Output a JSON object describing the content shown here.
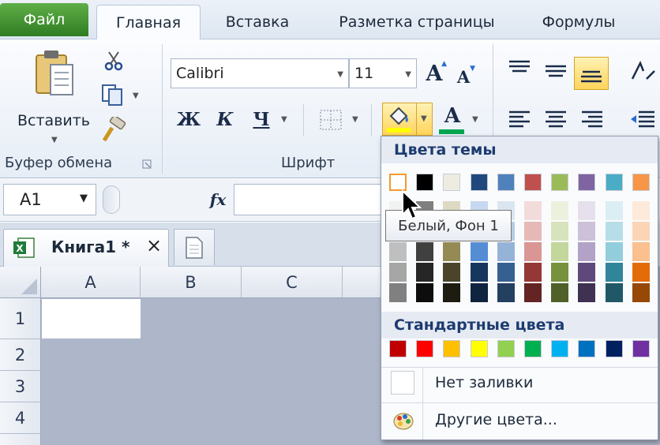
{
  "tabs": {
    "file": "Файл",
    "home": "Главная",
    "insert": "Вставка",
    "page_layout": "Разметка страницы",
    "formulas": "Формулы"
  },
  "clipboard": {
    "paste_label": "Вставить",
    "group_label": "Буфер обмена"
  },
  "font": {
    "name": "Calibri",
    "size": "11",
    "group_label": "Шрифт",
    "bold": "Ж",
    "italic": "К",
    "underline": "Ч",
    "grow_glyph": "A",
    "shrink_glyph": "A",
    "font_color_glyph": "A",
    "font_color_bar": "#00a651",
    "fill_color_bar": "#ffff00"
  },
  "formula_bar": {
    "name_box": "A1",
    "fx_label": "fx"
  },
  "workbook": {
    "tab_title": "Книга1 *",
    "close_glyph": "×"
  },
  "grid": {
    "columns": [
      "A",
      "B",
      "C"
    ],
    "rows": [
      "1",
      "2",
      "3",
      "4"
    ],
    "selected_cell": "A1"
  },
  "palette": {
    "theme_title": "Цвета темы",
    "theme_colors": [
      "#ffffff",
      "#000000",
      "#eeece1",
      "#1f497d",
      "#4f81bd",
      "#c0504d",
      "#9bbb59",
      "#8064a2",
      "#4bacc6",
      "#f79646"
    ],
    "theme_shades": [
      [
        "#f2f2f2",
        "#d9d9d9",
        "#bfbfbf",
        "#a6a6a6",
        "#808080"
      ],
      [
        "#7f7f7f",
        "#595959",
        "#404040",
        "#262626",
        "#0d0d0d"
      ],
      [
        "#ddd9c3",
        "#c4bd97",
        "#948a54",
        "#4a452a",
        "#1e1c11"
      ],
      [
        "#c6d9f0",
        "#8db3e2",
        "#548dd4",
        "#17365d",
        "#0f243e"
      ],
      [
        "#dbe5f1",
        "#b8cce4",
        "#95b3d7",
        "#366092",
        "#244061"
      ],
      [
        "#f2dcdb",
        "#e5b9b7",
        "#d99694",
        "#953734",
        "#632423"
      ],
      [
        "#ebf1dd",
        "#d7e3bc",
        "#c3d69b",
        "#76923c",
        "#4f6128"
      ],
      [
        "#e5e0ec",
        "#ccc1d9",
        "#b2a2c7",
        "#5f497a",
        "#3f3151"
      ],
      [
        "#dbeef3",
        "#b7dde8",
        "#92cddc",
        "#31859b",
        "#205867"
      ],
      [
        "#fdeada",
        "#fbd5b5",
        "#fac08f",
        "#e36c09",
        "#974806"
      ]
    ],
    "standard_title": "Стандартные цвета",
    "standard_colors": [
      "#c00000",
      "#ff0000",
      "#ffc000",
      "#ffff00",
      "#92d050",
      "#00b050",
      "#00b0f0",
      "#0070c0",
      "#002060",
      "#7030a0"
    ],
    "no_fill_label": "Нет заливки",
    "more_colors_label": "Другие цвета...",
    "tooltip": "Белый, Фон 1"
  }
}
